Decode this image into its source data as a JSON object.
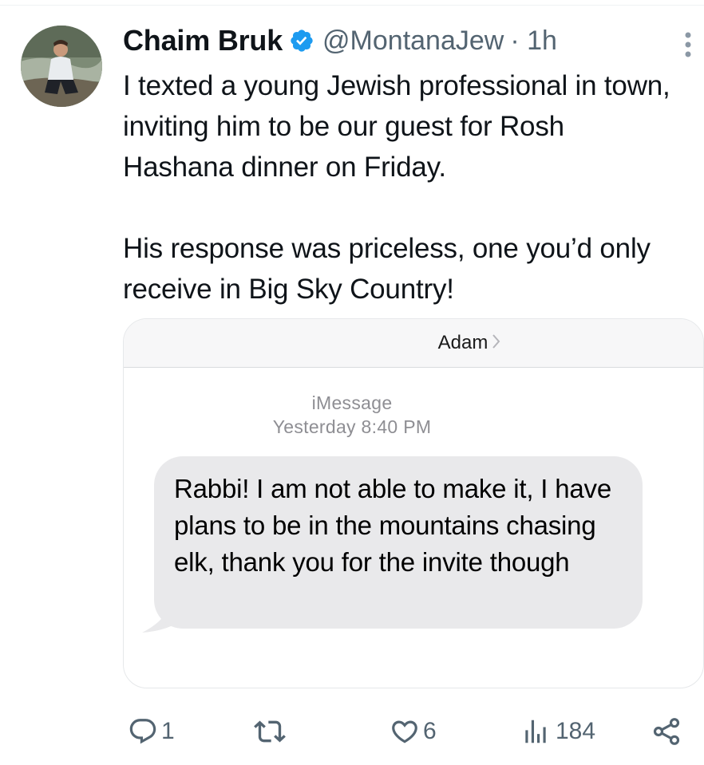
{
  "tweet": {
    "author_name": "Chaim Bruk",
    "handle": "@MontanaJew",
    "time": "· 1h",
    "paragraph1": "I texted a young Jewish professional in town, inviting him to be our guest for Rosh Hashana dinner on Friday.",
    "paragraph2": "His response was priceless, one you’d only receive in Big Sky Country!"
  },
  "screenshot": {
    "contact_name": "Adam",
    "service": "iMessage",
    "timestamp": "Yesterday 8:40 PM",
    "message": "Rabbi! I am not able to make it, I have plans to be in the mountains chasing elk, thank you for the invite though"
  },
  "actions": {
    "replies": "1",
    "retweets": "",
    "likes": "6",
    "views": "184"
  },
  "colors": {
    "verified_blue": "#1d9bf0",
    "muted_text": "#536471",
    "bubble_gray": "#e9e9eb"
  },
  "icons": [
    "verified-badge-icon",
    "more-options-icon",
    "reply-icon",
    "retweet-icon",
    "like-icon",
    "views-icon",
    "share-icon"
  ]
}
